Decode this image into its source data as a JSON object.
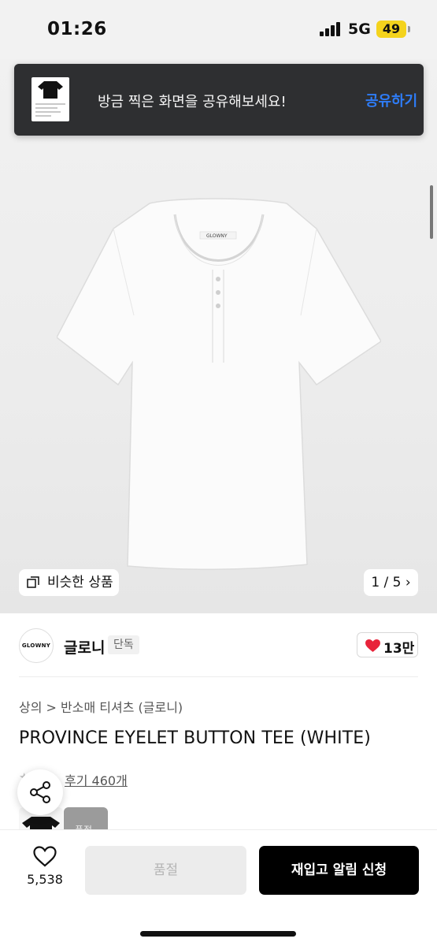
{
  "status_bar": {
    "time": "01:26",
    "network": "5G",
    "battery": "49"
  },
  "toast": {
    "message": "방금 찍은 화면을 공유해보세요!",
    "action": "공유하기"
  },
  "gallery": {
    "similar_label": "비슷한 상품",
    "pager": "1 / 5 ›",
    "label_tag": "GLOWNY"
  },
  "brand": {
    "logo_text": "GLOWNY",
    "name": "글로니",
    "tag": "단독",
    "likes": "13만"
  },
  "product": {
    "breadcrumb": "상의 > 반소매 티셔츠 (글로니)",
    "title": "PROVINCE EYELET BUTTON TEE (WHITE)",
    "reviews": "후기 460개",
    "gray_option_label": "품절"
  },
  "bottom_bar": {
    "wish_count": "5,538",
    "soldout_label": "품절",
    "restock_label": "재입고 알림 신청"
  },
  "colors": {
    "accent_blue": "#2e7cf6",
    "heart_red": "#e8233a",
    "toast_bg": "#2e2f31",
    "battery_yellow": "#f4d31d"
  }
}
